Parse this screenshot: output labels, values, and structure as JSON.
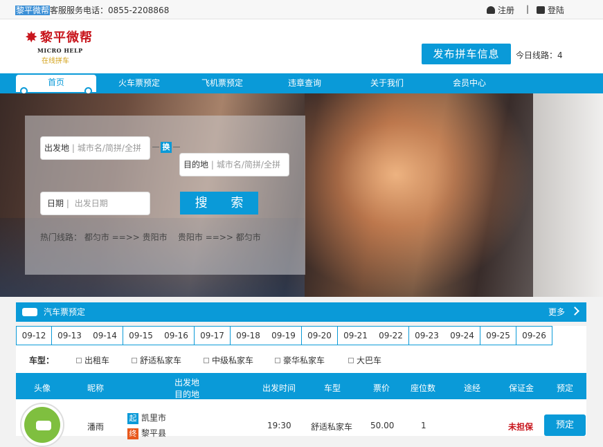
{
  "topbar": {
    "brand": "黎平微帮",
    "service": "客服服务电话：0855-2208868",
    "register": "注册",
    "separator": "|",
    "login": "登陆"
  },
  "header": {
    "logo_cn": "黎平微帮",
    "logo_en": "MICRO HELP",
    "logo_slogan": "在线拼车",
    "publish": "发布拼车信息",
    "today_routes": "今日线路：4"
  },
  "nav": [
    "首页",
    "火车票预定",
    "飞机票预定",
    "违章查询",
    "关于我们",
    "会员中心"
  ],
  "search": {
    "from_label": "出发地",
    "from_placeholder": "城市名/简拼/全拼",
    "swap": "换",
    "to_label": "目的地",
    "to_placeholder": "城市名/简拼/全拼",
    "date_label": "日期",
    "date_placeholder": "出发日期",
    "button": "搜 索",
    "hot_routes": "热门线路： 都匀市 ==>> 贵阳市    贵阳市 ==>> 都匀市"
  },
  "panel": {
    "title": "汽车票预定",
    "more": "更多"
  },
  "dates": [
    "09-12",
    "09-13",
    "09-14",
    "09-15",
    "09-16",
    "09-17",
    "09-18",
    "09-19",
    "09-20",
    "09-21",
    "09-22",
    "09-23",
    "09-24",
    "09-25",
    "09-26"
  ],
  "filters": {
    "title": "车型：",
    "options": [
      "出租车",
      "舒适私家车",
      "中级私家车",
      "豪华私家车",
      "大巴车"
    ]
  },
  "table": {
    "headers": {
      "avatar": "头像",
      "nickname": "昵称",
      "from": "出发地",
      "to": "目的地",
      "time": "出发时间",
      "cartype": "车型",
      "price": "票价",
      "seats": "座位数",
      "via": "途经",
      "deposit": "保证金",
      "book": "预定"
    },
    "rows": [
      {
        "nickname": "潘雨",
        "start_tag": "起",
        "from": "凯里市",
        "end_tag": "终",
        "to": "黎平县",
        "time": "19:30",
        "cartype": "舒适私家车",
        "price": "50.00",
        "seats": "1",
        "deposit": "未担保",
        "book": "预定"
      }
    ]
  },
  "colors": {
    "accent": "#0a9ad8",
    "logo_red": "#c8161d",
    "deposit_red": "#c8161d",
    "end_tag": "#e8581c"
  }
}
